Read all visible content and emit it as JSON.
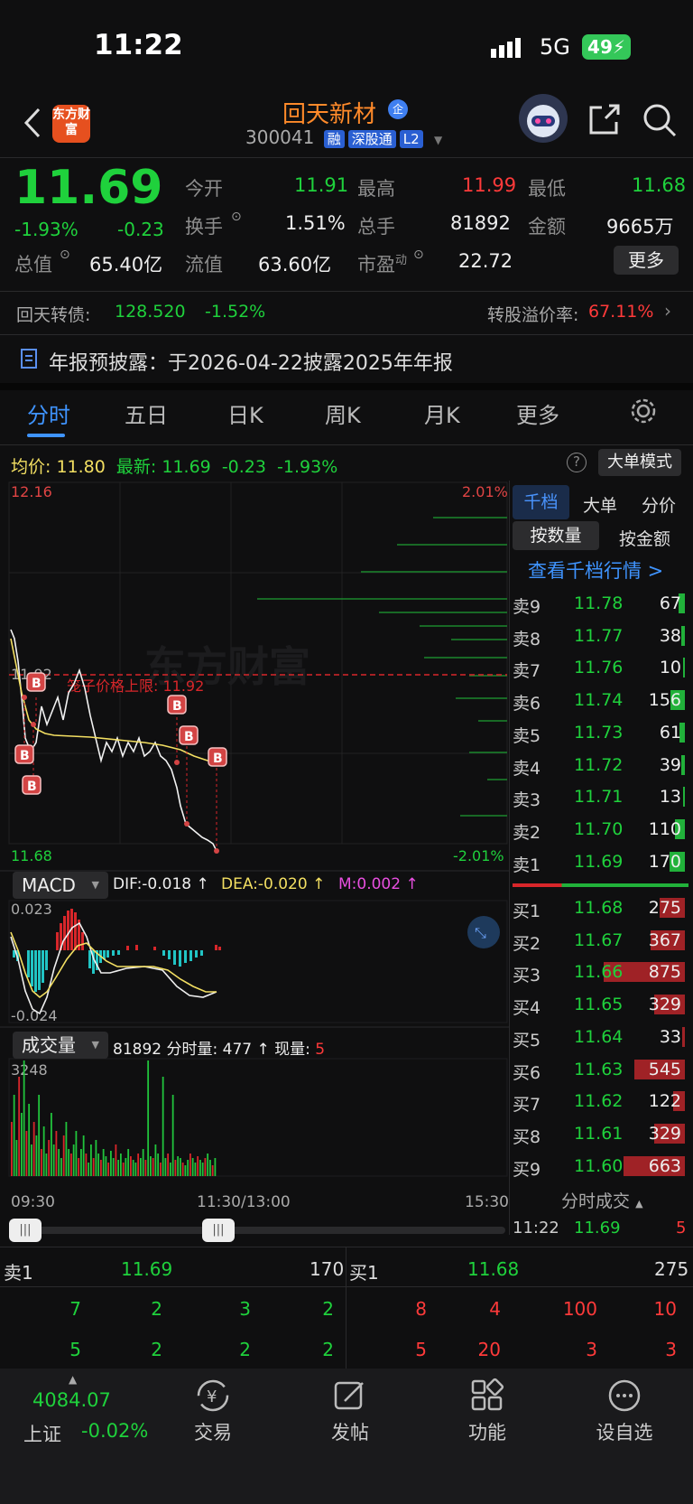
{
  "status": {
    "time": "11:22",
    "network": "5G",
    "battery": "49"
  },
  "header": {
    "logo_text": "东方财富",
    "stock_name": "回天新材",
    "stock_name_badge": "企",
    "stock_code": "300041",
    "tags": [
      "融",
      "深股通",
      "L2"
    ]
  },
  "quote": {
    "price": "11.69",
    "change_pct": "-1.93%",
    "change": "-0.23",
    "open_label": "今开",
    "open": "11.91",
    "high_label": "最高",
    "high": "11.99",
    "low_label": "最低",
    "low": "11.68",
    "turnover_label": "换手",
    "turnover": "1.51%",
    "volume_label": "总手",
    "volume": "81892",
    "amount_label": "金额",
    "amount": "9665万",
    "mcap_label": "总值",
    "mcap": "65.40亿",
    "float_label": "流值",
    "float_mcap": "63.60亿",
    "pe_label": "市盈",
    "pe_sup": "动",
    "pe": "22.72",
    "more_label": "更多"
  },
  "bond": {
    "label": "回天转债:",
    "price": "128.520",
    "pct": "-1.52%",
    "premium_label": "转股溢价率:",
    "premium": "67.11%"
  },
  "notice": {
    "text": "年报预披露：于2026-04-22披露2025年年报"
  },
  "tabs": [
    "分时",
    "五日",
    "日K",
    "周K",
    "月K",
    "更多"
  ],
  "chart_info": {
    "avg_label": "均价:",
    "avg": "11.80",
    "latest_label": "最新:",
    "latest": "11.69",
    "chg": "-0.23",
    "pct": "-1.93%",
    "big_mode": "大单模式"
  },
  "chart_labels": {
    "top_price": "12.16",
    "top_pct": "2.01%",
    "mid_price": "11.92",
    "limit_text": "笼子价格上限: 11.92",
    "bot_price": "11.68",
    "bot_pct": "-2.01%",
    "watermark": "东方财富"
  },
  "macd": {
    "name": "MACD",
    "dif": "DIF:-0.018 ↑",
    "dea": "DEA:-0.020 ↑",
    "m": "M:0.002 ↑",
    "top": "0.023",
    "bot": "-0.024"
  },
  "volume_ind": {
    "name": "成交量",
    "total": "81892",
    "fen_label": "分时量:",
    "fen": "477 ↑",
    "now_label": "现量:",
    "now": "5",
    "max": "3248"
  },
  "time_axis": [
    "09:30",
    "11:30/13:00",
    "15:30"
  ],
  "orderbook": {
    "tabs": [
      "千档",
      "大单",
      "分价"
    ],
    "sub_tabs": [
      "按数量",
      "按金额"
    ],
    "link": "查看千档行情 >",
    "asks": [
      {
        "l": "卖9",
        "p": "11.78",
        "v": "67"
      },
      {
        "l": "卖8",
        "p": "11.77",
        "v": "38"
      },
      {
        "l": "卖7",
        "p": "11.76",
        "v": "10"
      },
      {
        "l": "卖6",
        "p": "11.74",
        "v": "156"
      },
      {
        "l": "卖5",
        "p": "11.73",
        "v": "61"
      },
      {
        "l": "卖4",
        "p": "11.72",
        "v": "39"
      },
      {
        "l": "卖3",
        "p": "11.71",
        "v": "13"
      },
      {
        "l": "卖2",
        "p": "11.70",
        "v": "110"
      },
      {
        "l": "卖1",
        "p": "11.69",
        "v": "170"
      }
    ],
    "bids": [
      {
        "l": "买1",
        "p": "11.68",
        "v": "275"
      },
      {
        "l": "买2",
        "p": "11.67",
        "v": "367"
      },
      {
        "l": "买3",
        "p": "11.66",
        "v": "875"
      },
      {
        "l": "买4",
        "p": "11.65",
        "v": "329"
      },
      {
        "l": "买5",
        "p": "11.64",
        "v": "33"
      },
      {
        "l": "买6",
        "p": "11.63",
        "v": "545"
      },
      {
        "l": "买7",
        "p": "11.62",
        "v": "122"
      },
      {
        "l": "买8",
        "p": "11.61",
        "v": "329"
      },
      {
        "l": "买9",
        "p": "11.60",
        "v": "663"
      }
    ],
    "fenshi_label": "分时成交",
    "tick": {
      "time": "11:22",
      "price": "11.69",
      "vol": "5"
    }
  },
  "queue": {
    "ask_label": "卖1",
    "ask_price": "11.69",
    "ask_vol": "170",
    "bid_label": "买1",
    "bid_price": "11.68",
    "bid_vol": "275",
    "ask_rows": [
      [
        "7",
        "2",
        "3",
        "2"
      ],
      [
        "5",
        "2",
        "2",
        "2"
      ]
    ],
    "bid_rows": [
      [
        "8",
        "4",
        "100",
        "10"
      ],
      [
        "5",
        "20",
        "3",
        "3"
      ]
    ]
  },
  "bottom": {
    "index_value": "4084.07",
    "index_name": "上证",
    "index_pct": "-0.02%",
    "items": [
      "交易",
      "发帖",
      "功能",
      "设自选"
    ]
  }
}
